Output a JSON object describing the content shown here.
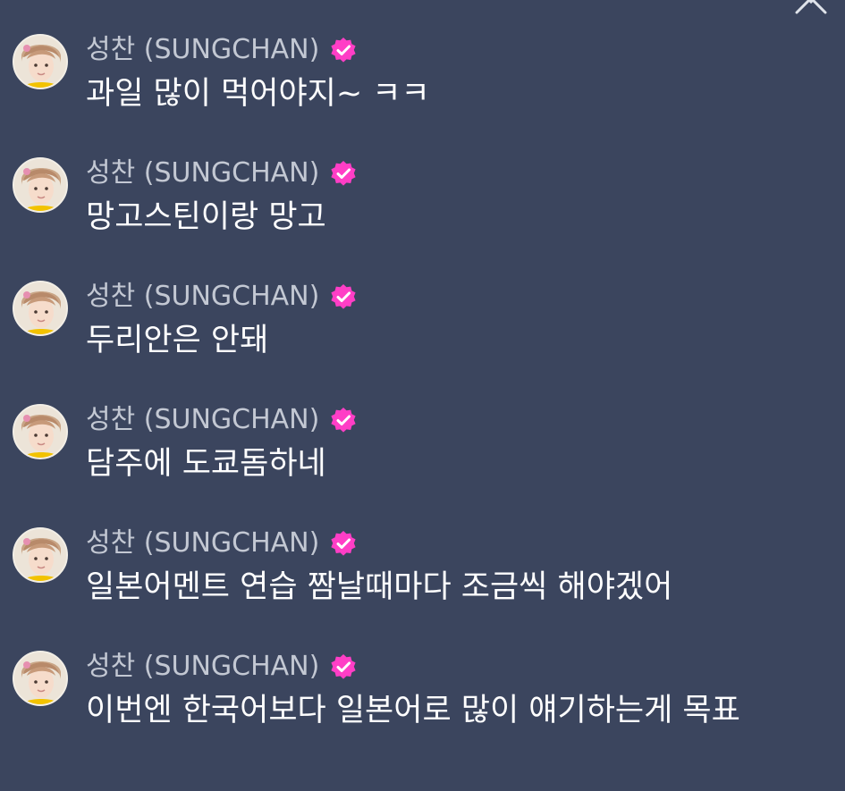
{
  "colors": {
    "background": "#3b455e",
    "username": "#c3c8d3",
    "message_text": "#ffffff",
    "verified_badge": "#ff3ec6",
    "close_icon": "#dfe3ea"
  },
  "header": {
    "close_icon": "close-icon"
  },
  "messages": [
    {
      "user": "성찬 (SUNGCHAN)",
      "verified_icon": "verified-badge-icon",
      "text": "과일 많이 먹어야지~ ㅋㅋ"
    },
    {
      "user": "성찬 (SUNGCHAN)",
      "verified_icon": "verified-badge-icon",
      "text": "망고스틴이랑 망고"
    },
    {
      "user": "성찬 (SUNGCHAN)",
      "verified_icon": "verified-badge-icon",
      "text": "두리안은 안돼"
    },
    {
      "user": "성찬 (SUNGCHAN)",
      "verified_icon": "verified-badge-icon",
      "text": "담주에 도쿄돔하네"
    },
    {
      "user": "성찬 (SUNGCHAN)",
      "verified_icon": "verified-badge-icon",
      "text": "일본어멘트 연습 짬날때마다 조금씩 해야겠어"
    },
    {
      "user": "성찬 (SUNGCHAN)",
      "verified_icon": "verified-badge-icon",
      "text": "이번엔 한국어보다 일본어로 많이 얘기하는게 목표"
    }
  ]
}
